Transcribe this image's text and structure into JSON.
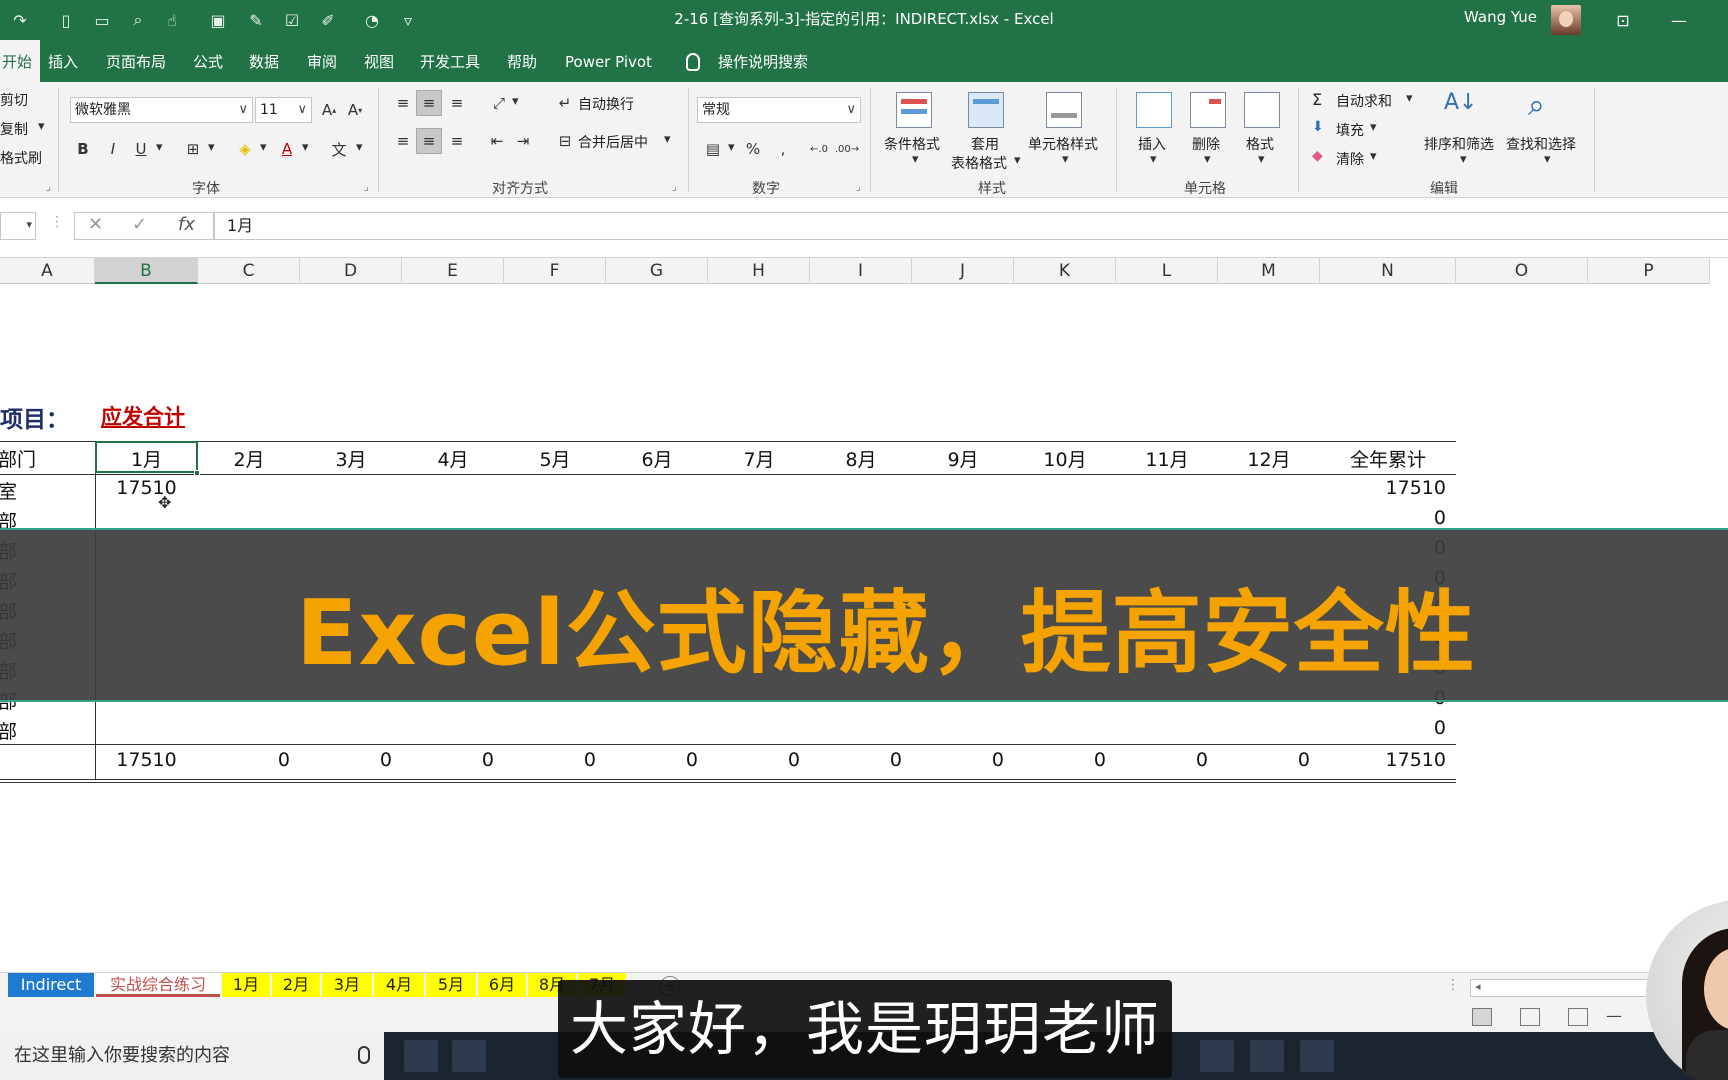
{
  "window": {
    "title": "2-16 [查询系列-3]-指定的引用：INDIRECT.xlsx  -  Excel",
    "user": "Wang Yue"
  },
  "menu": {
    "tabs": [
      "开始",
      "插入",
      "页面布局",
      "公式",
      "数据",
      "审阅",
      "视图",
      "开发工具",
      "帮助",
      "Power Pivot"
    ],
    "search": "操作说明搜索"
  },
  "ribbon": {
    "clipboard": {
      "cut": "剪切",
      "copy": "复制",
      "format_painter": "格式刷"
    },
    "font": {
      "name": "微软雅黑",
      "size": "11",
      "label": "字体",
      "bold": "B",
      "italic": "I",
      "underline": "U"
    },
    "alignment": {
      "wrap": "自动换行",
      "merge": "合并后居中",
      "label": "对齐方式"
    },
    "number": {
      "format": "常规",
      "percent": "%",
      "comma": ",",
      "label": "数字"
    },
    "styles": {
      "conditional": "条件格式",
      "table_line1": "套用",
      "table_line2": "表格格式",
      "cell_styles": "单元格样式",
      "label": "样式"
    },
    "cells": {
      "insert": "插入",
      "delete": "删除",
      "format": "格式",
      "label": "单元格"
    },
    "editing": {
      "autosum": "自动求和",
      "fill": "填充",
      "clear": "清除",
      "sort": "排序和筛选",
      "find": "查找和选择",
      "label": "编辑"
    }
  },
  "formula_bar": {
    "value": "1月",
    "fx": "fx"
  },
  "columns": [
    "A",
    "B",
    "C",
    "D",
    "E",
    "F",
    "G",
    "H",
    "I",
    "J",
    "K",
    "L",
    "M",
    "N",
    "O",
    "P"
  ],
  "sheet": {
    "project_label": "项目：",
    "project_value": "应发合计",
    "dept_header": "部门",
    "months": [
      "1月",
      "2月",
      "3月",
      "4月",
      "5月",
      "6月",
      "7月",
      "8月",
      "9月",
      "10月",
      "11月",
      "12月"
    ],
    "total_header": "全年累计",
    "rows": [
      {
        "dept": "室",
        "b": "17510",
        "total": "17510"
      },
      {
        "dept": "部",
        "b": "",
        "total": "0"
      },
      {
        "dept": "部",
        "b": "",
        "total": "0"
      },
      {
        "dept": "部",
        "b": "",
        "total": "0"
      },
      {
        "dept": "部",
        "b": "",
        "total": "0"
      },
      {
        "dept": "部",
        "b": "",
        "total": "0"
      },
      {
        "dept": "部",
        "b": "",
        "total": "0"
      },
      {
        "dept": "部",
        "b": "",
        "total": "0"
      },
      {
        "dept": "部",
        "b": "",
        "total": "0"
      }
    ],
    "sum_row": [
      "17510",
      "0",
      "0",
      "0",
      "0",
      "0",
      "0",
      "0",
      "0",
      "0",
      "0",
      "0",
      "17510"
    ]
  },
  "banner": {
    "text": "Excel公式隐藏，提高安全性",
    "color": "#f5a300"
  },
  "sheet_tabs": [
    "Indirect",
    "实战综合练习",
    "1月",
    "2月",
    "3月",
    "4月",
    "5月",
    "6月",
    "8月",
    "7月"
  ],
  "taskbar": {
    "search_placeholder": "在这里输入你要搜索的内容"
  },
  "subtitle": "大家好，我是玥玥老师",
  "colors": {
    "excel_green": "#217346",
    "red_label": "#c00000",
    "navy_label": "#1f2d6b",
    "tab_yellow": "#ffff00",
    "tab_blue": "#1e7bd0"
  }
}
